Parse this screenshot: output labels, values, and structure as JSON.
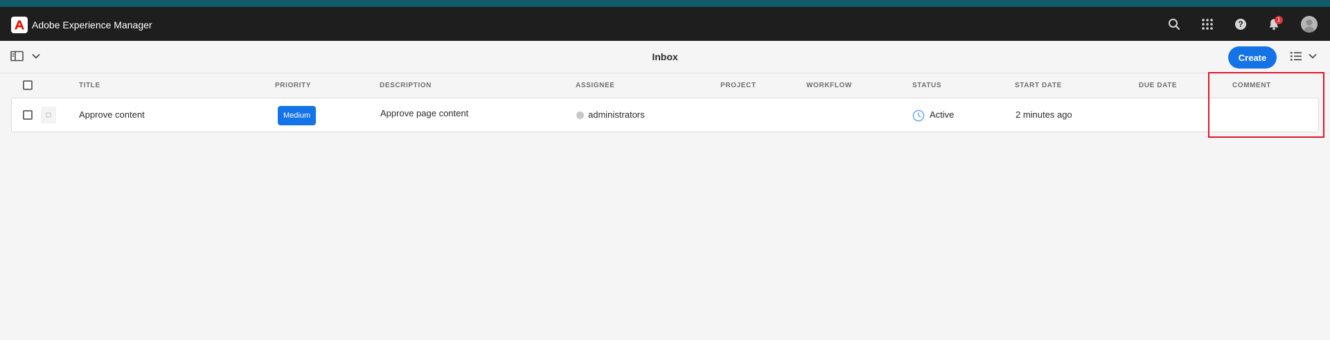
{
  "colors": {
    "accent_strip": "#125c69",
    "topbar": "#1e1e1e",
    "primary": "#1473e6",
    "highlight": "#e0162b",
    "notification_badge": "#d7373f"
  },
  "app": {
    "name": "Adobe Experience Manager"
  },
  "topbar": {
    "icons": [
      "search-icon",
      "apps-grid-icon",
      "help-icon",
      "bell-icon",
      "user-avatar"
    ],
    "notification_count": "1"
  },
  "actionbar": {
    "title": "Inbox",
    "create_label": "Create",
    "rail_toggle_icon": "side-panel-icon",
    "view_toggle_icon": "list-view-icon"
  },
  "table": {
    "columns": {
      "title": "TITLE",
      "priority": "PRIORITY",
      "description": "DESCRIPTION",
      "assignee": "ASSIGNEE",
      "project": "PROJECT",
      "workflow": "WORKFLOW",
      "status": "STATUS",
      "start_date": "START DATE",
      "due_date": "DUE DATE",
      "comment": "COMMENT"
    },
    "rows": [
      {
        "title": "Approve content",
        "priority": "Medium",
        "description": "Approve page content",
        "assignee": "administrators",
        "project": "",
        "workflow": "",
        "status": "Active",
        "status_icon": "clock-icon",
        "start_date": "2 minutes ago",
        "due_date": "",
        "comment": ""
      }
    ]
  }
}
